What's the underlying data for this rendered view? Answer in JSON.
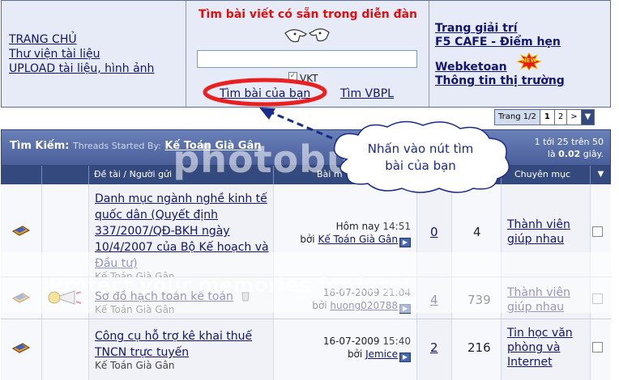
{
  "top_panel": {
    "left_links": [
      "TRANG CHỦ",
      "Thư viện tài liệu",
      "UPLOAD tài liệu, hình ảnh"
    ],
    "search_title": "Tìm bài viết có sẵn trong diễn đàn",
    "search_value": "",
    "checkbox_label": "VKT",
    "find_my_posts": "Tìm bài của bạn",
    "find_vbpl": "Tìm VBPL",
    "right_links": [
      "Trang giải trí",
      "F5 CAFE - Điểm hẹn",
      "Webketoan",
      "Thông tin thị trường"
    ],
    "new_badge": "NEW"
  },
  "pager": {
    "label": "Trang 1/2",
    "pages": [
      "1",
      "2"
    ],
    "next": ">",
    "menu": "▼"
  },
  "results_bar": {
    "title": "Tìm Kiếm:",
    "subtitle": "Threads Started By:",
    "author": "Kế Toán Già Gân",
    "count_line1": "1 tới 25 trên 50",
    "count_line2_prefix": "là",
    "count_time": "0.02",
    "count_line2_suffix": "giây."
  },
  "columns": {
    "topic": "Đề tài / Người gửi",
    "last": "Bài m",
    "forum": "Chuyên mục",
    "menu": "▼"
  },
  "callout": {
    "line1": "Nhấn vào nút tìm",
    "line2": "bài của bạn"
  },
  "watermark": {
    "main": "photobucket",
    "sub": "Protect your memories for less!"
  },
  "threads": [
    {
      "title": "Danh mục ngành nghề kinh tế quốc dân (Quyết định 337/2007/QĐ-BKH ngày 10/4/2007 của Bộ Kế hoạch và Đầu tư)",
      "starter": "Kế Toán Già Gân",
      "date": "Hôm nay",
      "time": "14:51",
      "by": "bởi",
      "last_user": "Kế Toán Già Gân",
      "replies": "0",
      "views": "4",
      "forum": "Thành viên giúp nhau"
    },
    {
      "title": "Sơ đồ hạch toán kế toán",
      "starter": "Kế Toán Già Gân",
      "date": "18-07-2009",
      "time": "21:04",
      "by": "bởi",
      "last_user": "huong020788",
      "replies": "4",
      "views": "739",
      "forum": "Thành viên giúp nhau"
    },
    {
      "title": "Công cụ hỗ trợ kê khai thuế TNCN trực tuyến",
      "starter": "Kế Toán Già Gân",
      "date": "16-07-2009",
      "time": "15:40",
      "by": "bởi",
      "last_user": "Jemice",
      "replies": "2",
      "views": "216",
      "forum": "Tin học văn phòng và Internet"
    }
  ],
  "colors": {
    "header_bg": "#34497e",
    "bar_bg": "#4a5f9a",
    "search_title": "#e01010",
    "link": "#12156f",
    "callout_text": "#1a2a8a"
  }
}
